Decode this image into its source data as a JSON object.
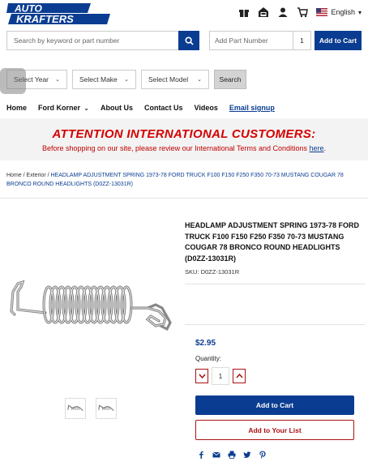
{
  "header": {
    "logo_text": "AUTO KRAFTERS",
    "language": "English",
    "icons": [
      "gift-icon",
      "garage-icon",
      "user-icon",
      "cart-icon"
    ]
  },
  "search": {
    "placeholder": "Search by keyword or part number",
    "part_placeholder": "Add Part Number",
    "qty": "1",
    "add_to_cart_label": "Add to Cart"
  },
  "vehicle_select": {
    "year": "Select Year",
    "make": "Select Make",
    "model": "Select Model",
    "search_label": "Search"
  },
  "nav": {
    "home": "Home",
    "ford_korner": "Ford Korner",
    "about": "About Us",
    "contact": "Contact Us",
    "videos": "Videos",
    "email_signup": "Email signup"
  },
  "notice": {
    "title": "ATTENTION INTERNATIONAL CUSTOMERS:",
    "text": "Before shopping on our site, please review our International Terms and Conditions ",
    "link": "here",
    "end": "."
  },
  "breadcrumb": {
    "home": "Home",
    "sep1": " / ",
    "exterior": "Exterior",
    "sep2": " / ",
    "current": "HEADLAMP ADJUSTMENT SPRING 1973-78 FORD TRUCK F100 F150 F250 F350 70-73 MUSTANG COUGAR 78 BRONCO ROUND HEADLIGHTS (D0ZZ-13031R)"
  },
  "product": {
    "title": "HEADLAMP ADJUSTMENT SPRING 1973-78 FORD TRUCK F100 F150 F250 F350 70-73 MUSTANG COUGAR 78 BRONCO ROUND HEADLIGHTS (D0ZZ-13031R)",
    "sku": "SKU: D0ZZ-13031R",
    "price": "$2.95",
    "quantity_label": "Quantity:",
    "quantity": "1",
    "add_to_cart": "Add to Cart",
    "add_to_list": "Add to Your List"
  },
  "colors": {
    "brand_blue": "#0a3d91",
    "alert_red": "#d40000",
    "accent_red": "#aa1111"
  }
}
